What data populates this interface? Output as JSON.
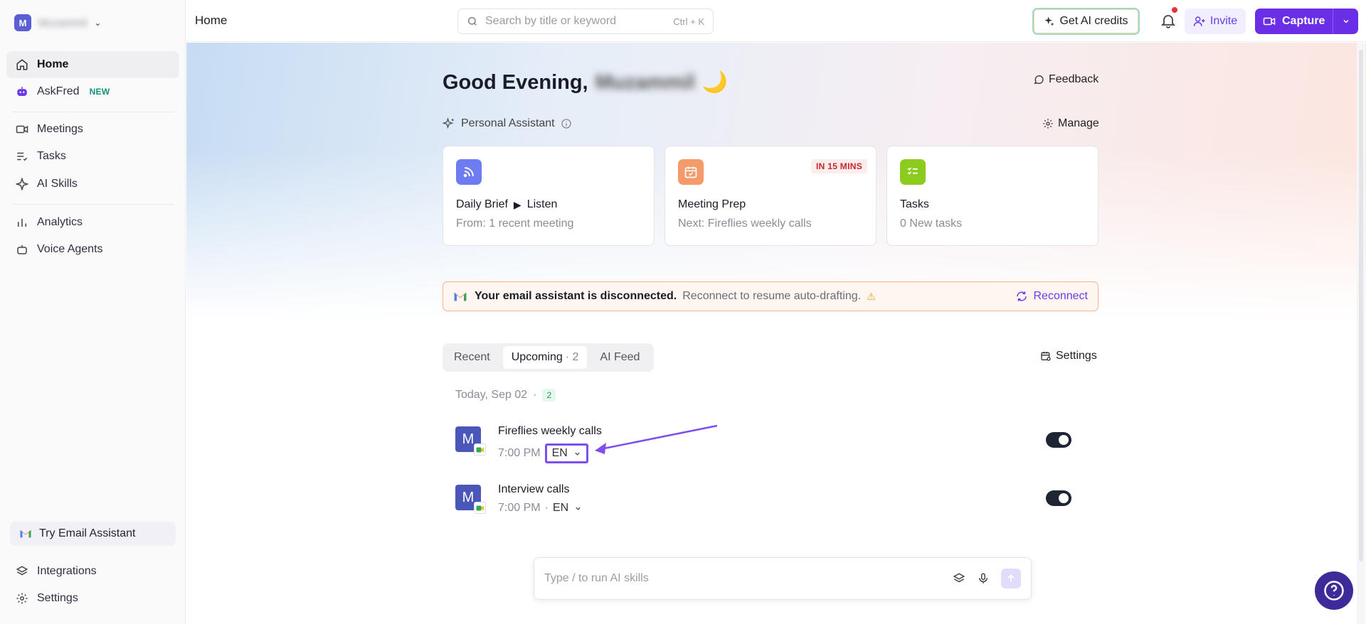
{
  "workspace": {
    "initial": "M",
    "name": "Muzammil"
  },
  "sidebar": {
    "items": [
      {
        "label": "Home"
      },
      {
        "label": "AskFred",
        "badge": "NEW"
      },
      {
        "label": "Meetings"
      },
      {
        "label": "Tasks"
      },
      {
        "label": "AI Skills"
      },
      {
        "label": "Analytics"
      },
      {
        "label": "Voice Agents"
      }
    ],
    "try_email": "Try Email Assistant",
    "integrations": "Integrations",
    "settings": "Settings"
  },
  "topbar": {
    "breadcrumb": "Home",
    "search_placeholder": "Search by title or keyword",
    "search_shortcut": "Ctrl + K",
    "credits_label": "Get AI credits",
    "invite_label": "Invite",
    "capture_label": "Capture"
  },
  "main": {
    "greeting": "Good Evening,",
    "greeting_name": "Muzammil",
    "greeting_emoji": "🌙",
    "feedback_label": "Feedback",
    "assistant_label": "Personal Assistant",
    "manage_label": "Manage",
    "cards": [
      {
        "title": "Daily Brief",
        "action": "Listen",
        "sub": "From: 1 recent meeting"
      },
      {
        "title": "Meeting Prep",
        "badge": "IN 15 MINS",
        "sub": "Next: Fireflies weekly calls"
      },
      {
        "title": "Tasks",
        "sub": "0 New tasks"
      }
    ],
    "alert": {
      "strong": "Your email assistant is disconnected.",
      "text": "Reconnect to resume auto-drafting.",
      "action": "Reconnect"
    },
    "tabs": [
      {
        "label": "Recent"
      },
      {
        "label": "Upcoming",
        "count": "· 2"
      },
      {
        "label": "AI Feed"
      }
    ],
    "settings_label": "Settings",
    "day_label": "Today, Sep 02",
    "day_sep": "·",
    "day_count": "2",
    "meetings": [
      {
        "initial": "M",
        "title": "Fireflies weekly calls",
        "time": "7:00 PM",
        "lang": "EN"
      },
      {
        "initial": "M",
        "title": "Interview calls",
        "time": "7:00 PM",
        "sep": "·",
        "lang": "EN"
      }
    ],
    "composer_placeholder": "Type / to run AI skills"
  },
  "colors": {
    "accent": "#6a2ee6",
    "sidebar_bg": "#fafafb",
    "alert_border": "#f6b38a",
    "toggle_on": "#1e2533",
    "help_bg": "#3f2a9a"
  }
}
